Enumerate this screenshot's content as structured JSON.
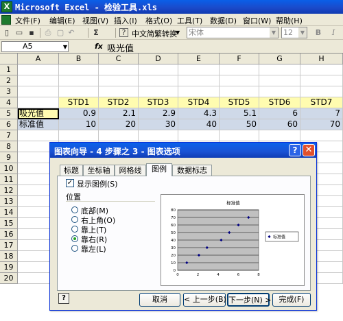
{
  "window": {
    "title": "Microsoft Excel - 检验工具.xls"
  },
  "menu": [
    "文件(F)",
    "编辑(E)",
    "视图(V)",
    "插入(I)",
    "格式(O)",
    "工具(T)",
    "数据(D)",
    "窗口(W)",
    "帮助(H)"
  ],
  "toolbar": {
    "chinese_convert": "中文简繁转换",
    "font_name": "宋体",
    "font_size": "12",
    "bold": "B",
    "italic": "I",
    "sigma": "Σ"
  },
  "formula_bar": {
    "name_box": "A5",
    "fx": "fx",
    "value": "吸光值"
  },
  "sheet": {
    "columns": [
      "A",
      "B",
      "C",
      "D",
      "E",
      "F",
      "G",
      "H"
    ],
    "rows": [
      "1",
      "2",
      "3",
      "4",
      "5",
      "6",
      "7",
      "8",
      "9",
      "10",
      "11",
      "12",
      "13",
      "14",
      "15",
      "16",
      "17",
      "18",
      "19",
      "20"
    ],
    "row4": [
      "",
      "STD1",
      "STD2",
      "STD3",
      "STD4",
      "STD5",
      "STD6",
      "STD7"
    ],
    "row5": [
      "吸光值",
      "0.9",
      "2.1",
      "2.9",
      "4.3",
      "5.1",
      "6",
      "7"
    ],
    "row6": [
      "标准值",
      "10",
      "20",
      "30",
      "40",
      "50",
      "60",
      "70"
    ]
  },
  "dialog": {
    "title": "图表向导 - 4 步骤之 3 - 图表选项",
    "tabs": [
      "标题",
      "坐标轴",
      "网格线",
      "图例",
      "数据标志"
    ],
    "show_legend_label": "显示图例(S)",
    "show_legend_checked": true,
    "position_title": "位置",
    "positions": [
      "底部(M)",
      "右上角(O)",
      "靠上(T)",
      "靠右(R)",
      "靠左(L)"
    ],
    "selected_position": "靠右(R)",
    "buttons": {
      "help": "?",
      "cancel": "取消",
      "back": "< 上一步(B)",
      "next": "下一步(N) >",
      "finish": "完成(F)"
    }
  },
  "chart_data": {
    "type": "scatter",
    "title": "标准值",
    "legend": "标准值",
    "legend_position": "right",
    "grid": true,
    "xlim": [
      0,
      8
    ],
    "ylim": [
      0,
      80
    ],
    "xticks": [
      "0",
      "2",
      "4",
      "6",
      "8"
    ],
    "yticks": [
      "0",
      "10",
      "20",
      "30",
      "40",
      "50",
      "60",
      "70",
      "80"
    ],
    "series": [
      {
        "name": "标准值",
        "x": [
          0.9,
          2.1,
          2.9,
          4.3,
          5.1,
          6,
          7
        ],
        "y": [
          10,
          20,
          30,
          40,
          50,
          60,
          70
        ]
      }
    ],
    "marker_color": "#000080"
  }
}
